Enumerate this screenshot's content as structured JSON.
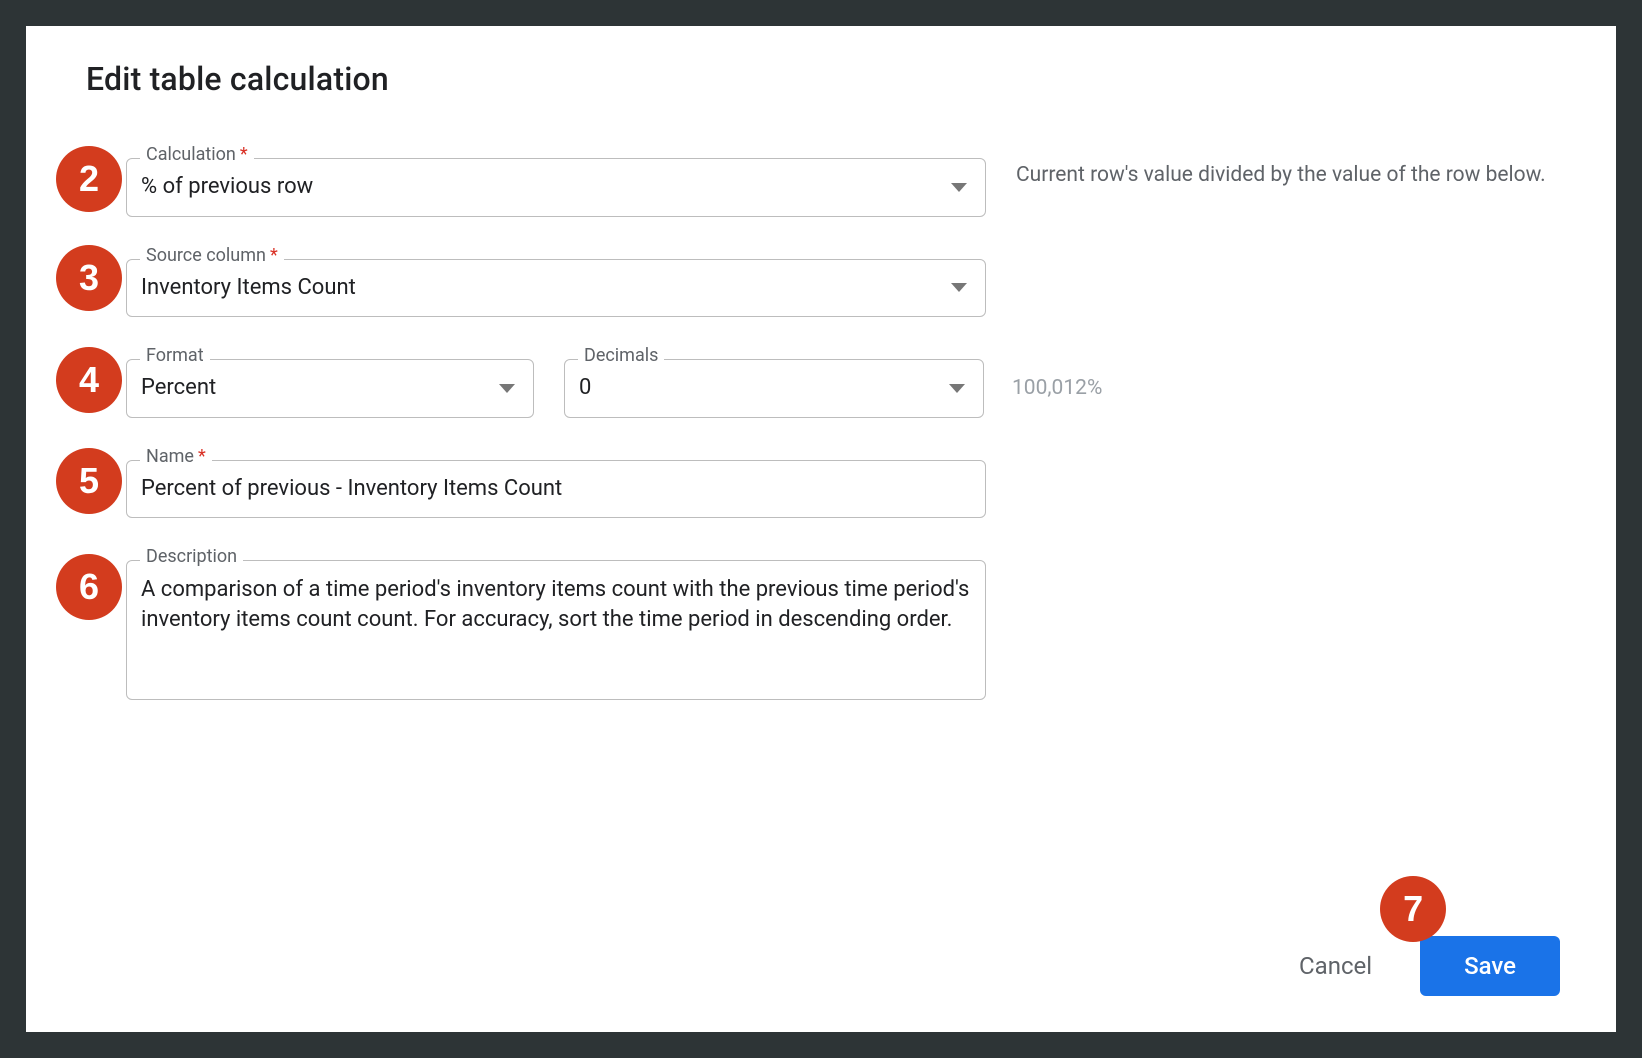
{
  "dialog": {
    "title": "Edit table calculation"
  },
  "annotations": {
    "n2": "2",
    "n3": "3",
    "n4": "4",
    "n5": "5",
    "n6": "6",
    "n7": "7"
  },
  "fields": {
    "calculation": {
      "label": "Calculation",
      "required": "*",
      "value": "% of previous row",
      "helper": "Current row's value divided by the value of the row below."
    },
    "source": {
      "label": "Source column",
      "required": "*",
      "value": "Inventory Items Count"
    },
    "format": {
      "label": "Format",
      "value": "Percent"
    },
    "decimals": {
      "label": "Decimals",
      "value": "0",
      "preview": "100,012%"
    },
    "name": {
      "label": "Name",
      "required": "*",
      "value": "Percent of previous -  Inventory Items Count"
    },
    "description": {
      "label": "Description",
      "value": "A comparison of a time period's inventory items count with the previous time period's inventory items count count. For accuracy, sort the time period in descending order."
    }
  },
  "footer": {
    "cancel": "Cancel",
    "save": "Save"
  }
}
